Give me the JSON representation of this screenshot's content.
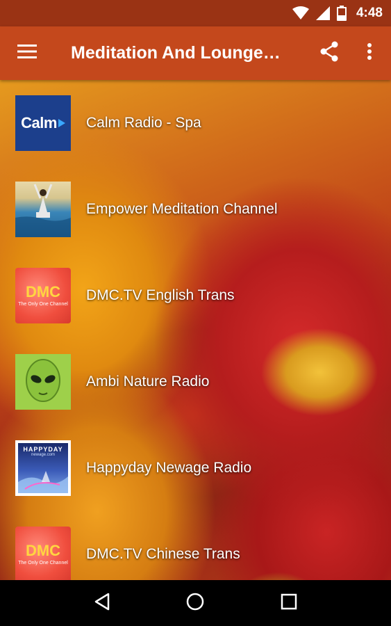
{
  "status_bar": {
    "time": "4:48"
  },
  "app_bar": {
    "title": "Meditation And Lounge…",
    "background_color": "#c4481c"
  },
  "stations": [
    {
      "name": "Calm Radio - Spa",
      "logo": "calm-logo",
      "logo_text": "Calm"
    },
    {
      "name": "Empower Meditation Channel",
      "logo": "empower-logo"
    },
    {
      "name": "DMC.TV English Trans",
      "logo": "dmc-logo",
      "logo_text": "DMC",
      "logo_subtext": "The Only One Channel"
    },
    {
      "name": "Ambi Nature Radio",
      "logo": "ambi-logo"
    },
    {
      "name": "Happyday Newage Radio",
      "logo": "happyday-logo",
      "logo_text": "HAPPYDAY",
      "logo_subtext": "newage.com"
    },
    {
      "name": "DMC.TV Chinese Trans",
      "logo": "dmc-logo",
      "logo_text": "DMC",
      "logo_subtext": "The Only One Channel"
    }
  ]
}
